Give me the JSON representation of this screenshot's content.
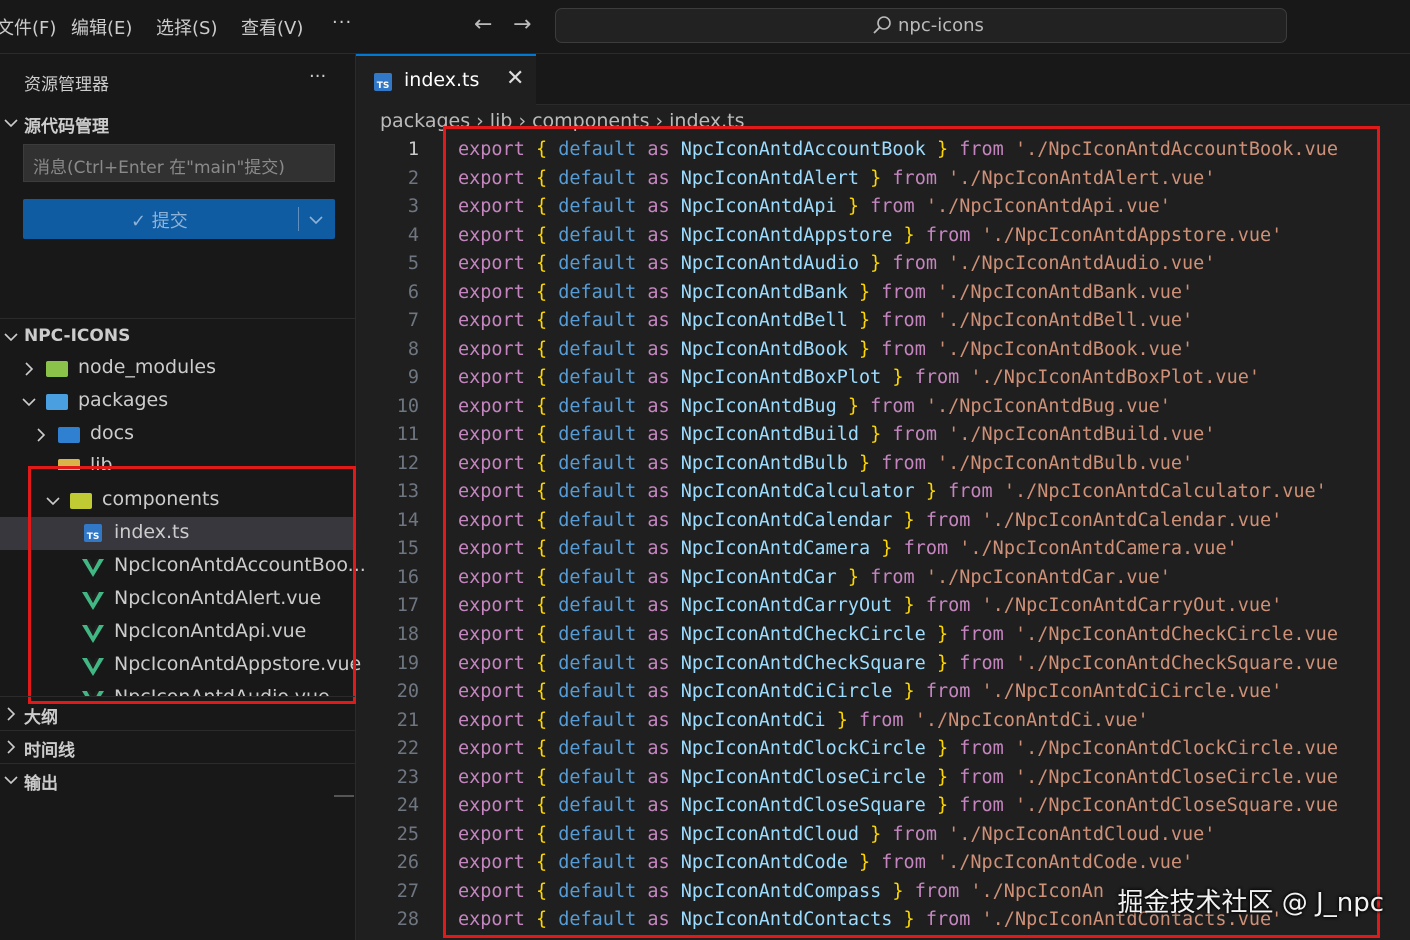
{
  "menu": {
    "file": "文件(F)",
    "edit": "编辑(E)",
    "select": "选择(S)",
    "view": "查看(V)",
    "more": "···"
  },
  "search": {
    "text": "npc-icons"
  },
  "explorer": {
    "title": "资源管理器",
    "more": "···"
  },
  "scm": {
    "title": "源代码管理",
    "placeholder": "消息(Ctrl+Enter 在\"main\"提交)",
    "commit_label": "✓ 提交"
  },
  "tree": {
    "root": "NPC-ICONS",
    "node_modules": "node_modules",
    "packages": "packages",
    "docs": "docs",
    "lib": "lib",
    "components": "components",
    "index": "index.ts",
    "files": [
      "NpcIconAntdAccountBoo...",
      "NpcIconAntdAlert.vue",
      "NpcIconAntdApi.vue",
      "NpcIconAntdAppstore.vue",
      "NpcIconAntdAudio.vue"
    ]
  },
  "panels": {
    "outline": "大纲",
    "timeline": "时间线",
    "output": "输出"
  },
  "tab": {
    "name": "index.ts",
    "icon_text": "TS"
  },
  "breadcrumb": {
    "text": "packages  ›  lib  ›  components  ›        index.ts"
  },
  "code": {
    "keywords": {
      "export": "export",
      "default": "default",
      "as": "as",
      "from": "from",
      "lbrace": "{",
      "rbrace": "}"
    },
    "lines": [
      {
        "n": "1",
        "name": "NpcIconAntdAccountBook",
        "path": "'./NpcIconAntdAccountBook.vue"
      },
      {
        "n": "2",
        "name": "NpcIconAntdAlert",
        "path": "'./NpcIconAntdAlert.vue'"
      },
      {
        "n": "3",
        "name": "NpcIconAntdApi",
        "path": "'./NpcIconAntdApi.vue'"
      },
      {
        "n": "4",
        "name": "NpcIconAntdAppstore",
        "path": "'./NpcIconAntdAppstore.vue'"
      },
      {
        "n": "5",
        "name": "NpcIconAntdAudio",
        "path": "'./NpcIconAntdAudio.vue'"
      },
      {
        "n": "6",
        "name": "NpcIconAntdBank",
        "path": "'./NpcIconAntdBank.vue'"
      },
      {
        "n": "7",
        "name": "NpcIconAntdBell",
        "path": "'./NpcIconAntdBell.vue'"
      },
      {
        "n": "8",
        "name": "NpcIconAntdBook",
        "path": "'./NpcIconAntdBook.vue'"
      },
      {
        "n": "9",
        "name": "NpcIconAntdBoxPlot",
        "path": "'./NpcIconAntdBoxPlot.vue'"
      },
      {
        "n": "10",
        "name": "NpcIconAntdBug",
        "path": "'./NpcIconAntdBug.vue'"
      },
      {
        "n": "11",
        "name": "NpcIconAntdBuild",
        "path": "'./NpcIconAntdBuild.vue'"
      },
      {
        "n": "12",
        "name": "NpcIconAntdBulb",
        "path": "'./NpcIconAntdBulb.vue'"
      },
      {
        "n": "13",
        "name": "NpcIconAntdCalculator",
        "path": "'./NpcIconAntdCalculator.vue'"
      },
      {
        "n": "14",
        "name": "NpcIconAntdCalendar",
        "path": "'./NpcIconAntdCalendar.vue'"
      },
      {
        "n": "15",
        "name": "NpcIconAntdCamera",
        "path": "'./NpcIconAntdCamera.vue'"
      },
      {
        "n": "16",
        "name": "NpcIconAntdCar",
        "path": "'./NpcIconAntdCar.vue'"
      },
      {
        "n": "17",
        "name": "NpcIconAntdCarryOut",
        "path": "'./NpcIconAntdCarryOut.vue'"
      },
      {
        "n": "18",
        "name": "NpcIconAntdCheckCircle",
        "path": "'./NpcIconAntdCheckCircle.vue"
      },
      {
        "n": "19",
        "name": "NpcIconAntdCheckSquare",
        "path": "'./NpcIconAntdCheckSquare.vue"
      },
      {
        "n": "20",
        "name": "NpcIconAntdCiCircle",
        "path": "'./NpcIconAntdCiCircle.vue'"
      },
      {
        "n": "21",
        "name": "NpcIconAntdCi",
        "path": "'./NpcIconAntdCi.vue'"
      },
      {
        "n": "22",
        "name": "NpcIconAntdClockCircle",
        "path": "'./NpcIconAntdClockCircle.vue"
      },
      {
        "n": "23",
        "name": "NpcIconAntdCloseCircle",
        "path": "'./NpcIconAntdCloseCircle.vue"
      },
      {
        "n": "24",
        "name": "NpcIconAntdCloseSquare",
        "path": "'./NpcIconAntdCloseSquare.vue"
      },
      {
        "n": "25",
        "name": "NpcIconAntdCloud",
        "path": "'./NpcIconAntdCloud.vue'"
      },
      {
        "n": "26",
        "name": "NpcIconAntdCode",
        "path": "'./NpcIconAntdCode.vue'"
      },
      {
        "n": "27",
        "name": "NpcIconAntdCompass",
        "path": "'./NpcIconAn"
      },
      {
        "n": "28",
        "name": "NpcIconAntdContacts",
        "path": "'./NpcIconAntdContacts.vue'"
      }
    ]
  },
  "watermark": "掘金技术社区 @ J_npc",
  "colors": {
    "accent": "#0078d4",
    "highlight_box": "#e11919",
    "keyword": "#c586c0",
    "keyword_blue": "#569cd6",
    "identifier": "#9cdcfe",
    "string": "#ce9178",
    "brace": "#ffd700"
  }
}
